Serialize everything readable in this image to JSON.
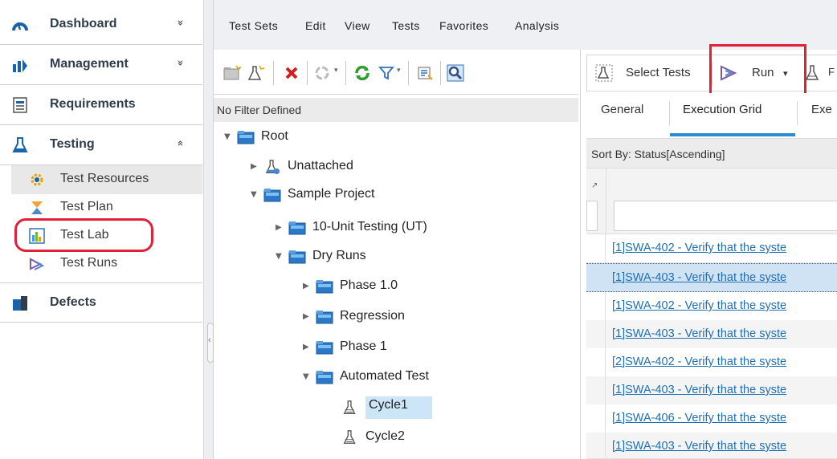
{
  "nav": {
    "sections": [
      {
        "label": "Dashboard",
        "icon": "dashboard-gauge-icon",
        "chevron": "»"
      },
      {
        "label": "Management",
        "icon": "management-bars-icon",
        "chevron": "»"
      },
      {
        "label": "Requirements",
        "icon": "requirements-doc-icon"
      },
      {
        "label": "Testing",
        "icon": "testing-flask-icon",
        "chevron": "«"
      },
      {
        "label": "Defects",
        "icon": "defects-icon"
      }
    ],
    "testing_items": [
      {
        "label": "Test Resources",
        "icon": "test-resources-gear-icon"
      },
      {
        "label": "Test Plan",
        "icon": "test-plan-icon"
      },
      {
        "label": "Test Lab",
        "icon": "test-lab-icon"
      },
      {
        "label": "Test Runs",
        "icon": "test-runs-icon"
      }
    ]
  },
  "menubar": [
    "Test Sets",
    "Edit",
    "View",
    "Tests",
    "Favorites",
    "Analysis"
  ],
  "tree": {
    "filter_text": "No Filter Defined",
    "nodes": [
      {
        "label": "Root",
        "twisty": "▼",
        "icon": "folder-icon"
      },
      {
        "label": "Unattached",
        "twisty": "▶",
        "icon": "test-set-flask-icon"
      },
      {
        "label": "Sample Project",
        "twisty": "▼",
        "icon": "folder-icon"
      },
      {
        "label": "10-Unit Testing (UT)",
        "twisty": "▶",
        "icon": "folder-icon"
      },
      {
        "label": "Dry Runs",
        "twisty": "▼",
        "icon": "folder-icon"
      },
      {
        "label": "Phase 1.0",
        "twisty": "▶",
        "icon": "folder-icon"
      },
      {
        "label": "Regression",
        "twisty": "▶",
        "icon": "folder-icon"
      },
      {
        "label": "Phase 1",
        "twisty": "▶",
        "icon": "folder-icon"
      },
      {
        "label": "Automated Test",
        "twisty": "▼",
        "icon": "folder-icon"
      },
      {
        "label": "Cycle1",
        "twisty": "",
        "icon": "test-set-flask-icon"
      },
      {
        "label": "Cycle2",
        "twisty": "",
        "icon": "test-set-flask-icon"
      }
    ]
  },
  "right": {
    "toolbar": {
      "select_tests": "Select Tests",
      "run": "Run",
      "run_dropdown": "▾"
    },
    "tabs": [
      "General",
      "Execution Grid",
      "Exe"
    ],
    "sort_text": "Sort By: Status[Ascending]",
    "rows": [
      "[1]SWA-402 - Verify that the syste",
      "[1]SWA-403 - Verify that the syste",
      "[1]SWA-402 - Verify that the syste",
      "[1]SWA-403 - Verify that the syste",
      "[2]SWA-402 - Verify that the syste",
      "[1]SWA-403 - Verify that the syste",
      "[1]SWA-406 - Verify that the syste",
      "[1]SWA-403 - Verify that the syste"
    ]
  },
  "colors": {
    "highlight": "#e2203a",
    "link": "#1f6fb5",
    "selection": "#cfe3f4",
    "accent": "#2a8ccf"
  }
}
